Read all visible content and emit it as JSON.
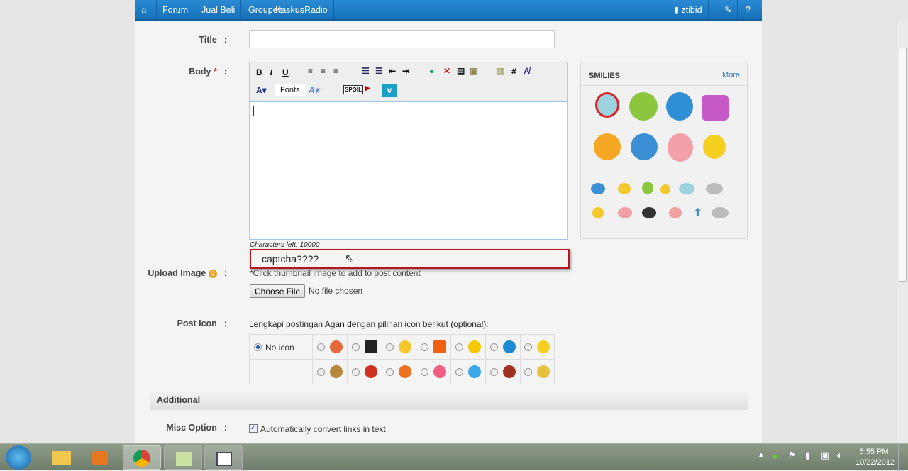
{
  "nav": {
    "items": [
      "Forum",
      "Jual Beli",
      "Groupee",
      "KaskusRadio"
    ],
    "user": "ztibid",
    "accent": "#1a7fc8"
  },
  "form": {
    "title_label": "Title",
    "body_label": "Body",
    "required_mark": "*",
    "colon": ":",
    "title_value": "",
    "toolbar": {
      "bold": "B",
      "italic": "I",
      "underline": "U",
      "fonts": "Fonts",
      "hash": "#"
    },
    "chars_left": "Characters left: 10000",
    "captcha": "captcha????",
    "upload_label": "Upload Image",
    "upload_hint": "*Click thumbnail image to add to post content",
    "choose_file": "Choose File",
    "no_file": "No file chosen",
    "post_icon_label": "Post Icon",
    "post_icon_hint": "Lengkapi postingan Agan dengan pilihan icon berikut (optional):",
    "no_icon": "No icon",
    "icons_row1": [
      "pencil",
      "clapper",
      "bulb",
      "warning",
      "star",
      "cool",
      "smile"
    ],
    "icons_row2": [
      "poop",
      "angry",
      "laugh",
      "heart",
      "grin",
      "burst",
      "thumb"
    ],
    "additional": "Additional",
    "misc_label": "Misc Option",
    "misc_option": "Automatically convert links in text",
    "misc_checked": true
  },
  "smilies": {
    "title": "SMILIES",
    "more": "More"
  },
  "taskbar": {
    "time": "5:55 PM",
    "date": "10/22/2012"
  }
}
